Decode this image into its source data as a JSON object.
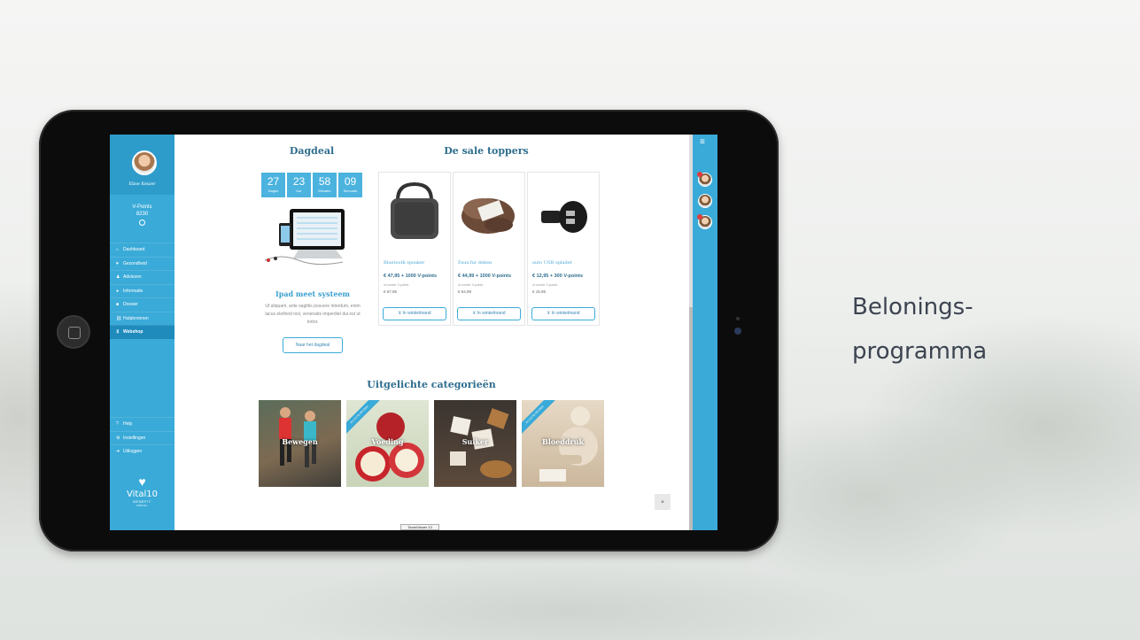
{
  "slide": {
    "title": "Belonings-\nprogramma"
  },
  "sidebar": {
    "user_name": "Elise Keizer",
    "points_label": "V-Points",
    "points_value": "8230",
    "nav": [
      {
        "label": "Dashboard",
        "icon": "home-icon",
        "glyph": "⌂",
        "active": false
      },
      {
        "label": "Gezondheid",
        "icon": "heart-icon",
        "glyph": "♥",
        "active": false
      },
      {
        "label": "Adviezen",
        "icon": "user-icon",
        "glyph": "♟",
        "active": false
      },
      {
        "label": "Informatie",
        "icon": "info-icon",
        "glyph": "●",
        "active": false
      },
      {
        "label": "Dossier",
        "icon": "folder-icon",
        "glyph": "■",
        "active": false
      },
      {
        "label": "Hulpbronnen",
        "icon": "link-icon",
        "glyph": "⛓",
        "active": false
      },
      {
        "label": "Webshop",
        "icon": "cart-icon",
        "glyph": "⊻",
        "active": true
      }
    ],
    "bottom_nav": [
      {
        "label": "Help",
        "icon": "help-icon",
        "glyph": "?"
      },
      {
        "label": "Instellingen",
        "icon": "gear-icon",
        "glyph": "⚙"
      },
      {
        "label": "Uitloggen",
        "icon": "logout-icon",
        "glyph": "➜"
      }
    ],
    "logo": {
      "brand": "Vital10",
      "tag": "BENEFIT",
      "tag2": "FOR ALL"
    }
  },
  "dagdeal": {
    "heading": "Dagdeal",
    "countdown": [
      {
        "value": "27",
        "label": "Dagen"
      },
      {
        "value": "23",
        "label": "Uur"
      },
      {
        "value": "58",
        "label": "Minuten"
      },
      {
        "value": "09",
        "label": "Seconde"
      }
    ],
    "product_title": "Ipad meet systeem",
    "description": "Ut aliquam, ante sagittis posuere interdum, enim lacus eleifend nisl, venenatis imperdiet dui est ut tortor.",
    "button": "Naar het dagdeal"
  },
  "sale": {
    "heading": "De sale toppers",
    "products": [
      {
        "name": "Bluetooth speaker",
        "price": "€ 47,95 + 1000 V-points",
        "old_label": "of zonder V-points",
        "old_price": "€ 57,95",
        "button": "In winkelmand"
      },
      {
        "name": "Faux fur deken",
        "price": "€ 44,99 + 1000 V-points",
        "old_label": "of zonder V-points",
        "old_price": "€ 54,99",
        "button": "In winkelmand"
      },
      {
        "name": "auto USB oplader",
        "price": "€ 12,95 + 300 V-points",
        "old_label": "of zonder V-points",
        "old_price": "€ 15,95",
        "button": "In winkelmand"
      }
    ]
  },
  "categories": {
    "heading": "Uitgelichte categorieën",
    "items": [
      {
        "label": "Bewegen",
        "ribbon": ""
      },
      {
        "label": "Voeding",
        "ribbon": "NU ACTIE PRIJZEN"
      },
      {
        "label": "Suiker",
        "ribbon": ""
      },
      {
        "label": "Bloeddruk",
        "ribbon": "NU ACTIE PRIJZEN"
      }
    ]
  },
  "teamviewer": "TeamViewer 13",
  "colors": {
    "accent": "#3aaad8",
    "heading": "#2f6e8e"
  }
}
